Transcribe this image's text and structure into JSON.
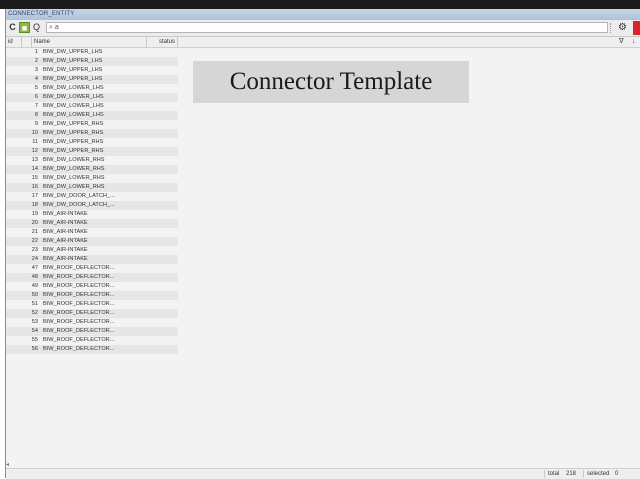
{
  "window": {
    "title": "CONNECTOR_ENTITY"
  },
  "toolbar": {
    "refresh_glyph": "C",
    "search_glyph": "Q",
    "search_value": "a",
    "settings_glyph": "⚙"
  },
  "columns": {
    "id": "id",
    "name": "Name",
    "status": "status"
  },
  "header_icons": {
    "filter": "∇",
    "sort": "↓"
  },
  "rows": [
    {
      "id": "1",
      "name": "BIW_DW_UPPER_LHS"
    },
    {
      "id": "2",
      "name": "BIW_DW_UPPER_LHS"
    },
    {
      "id": "3",
      "name": "BIW_DW_UPPER_LHS"
    },
    {
      "id": "4",
      "name": "BIW_DW_UPPER_LHS"
    },
    {
      "id": "5",
      "name": "BIW_DW_LOWER_LHS"
    },
    {
      "id": "6",
      "name": "BIW_DW_LOWER_LHS"
    },
    {
      "id": "7",
      "name": "BIW_DW_LOWER_LHS"
    },
    {
      "id": "8",
      "name": "BIW_DW_LOWER_LHS"
    },
    {
      "id": "9",
      "name": "BIW_DW_UPPER_RHS"
    },
    {
      "id": "10",
      "name": "BIW_DW_UPPER_RHS"
    },
    {
      "id": "11",
      "name": "BIW_DW_UPPER_RHS"
    },
    {
      "id": "12",
      "name": "BIW_DW_UPPER_RHS"
    },
    {
      "id": "13",
      "name": "BIW_DW_LOWER_RHS"
    },
    {
      "id": "14",
      "name": "BIW_DW_LOWER_RHS"
    },
    {
      "id": "15",
      "name": "BIW_DW_LOWER_RHS"
    },
    {
      "id": "16",
      "name": "BIW_DW_LOWER_RHS"
    },
    {
      "id": "17",
      "name": "BIW_DW_DOOR_LATCH_..."
    },
    {
      "id": "18",
      "name": "BIW_DW_DOOR_LATCH_..."
    },
    {
      "id": "19",
      "name": "BIW_AIR-INTAKE"
    },
    {
      "id": "20",
      "name": "BIW_AIR-INTAKE"
    },
    {
      "id": "21",
      "name": "BIW_AIR-INTAKE"
    },
    {
      "id": "22",
      "name": "BIW_AIR-INTAKE"
    },
    {
      "id": "23",
      "name": "BIW_AIR-INTAKE"
    },
    {
      "id": "24",
      "name": "BIW_AIR-INTAKE"
    },
    {
      "id": "47",
      "name": "BIW_ROOF_DEFLECTOR..."
    },
    {
      "id": "48",
      "name": "BIW_ROOF_DEFLECTOR..."
    },
    {
      "id": "49",
      "name": "BIW_ROOF_DEFLECTOR..."
    },
    {
      "id": "50",
      "name": "BIW_ROOF_DEFLECTOR..."
    },
    {
      "id": "51",
      "name": "BIW_ROOF_DEFLECTOR..."
    },
    {
      "id": "52",
      "name": "BIW_ROOF_DEFLECTOR..."
    },
    {
      "id": "53",
      "name": "BIW_ROOF_DEFLECTOR..."
    },
    {
      "id": "54",
      "name": "BIW_ROOF_DEFLECTOR..."
    },
    {
      "id": "55",
      "name": "BIW_ROOF_DEFLECTOR..."
    },
    {
      "id": "56",
      "name": "BIW_ROOF_DEFLECTOR..."
    }
  ],
  "overlay": {
    "title": "Connector Template"
  },
  "status": {
    "total_label": "total",
    "total": "218",
    "selected_label": "selected",
    "selected": "0"
  }
}
